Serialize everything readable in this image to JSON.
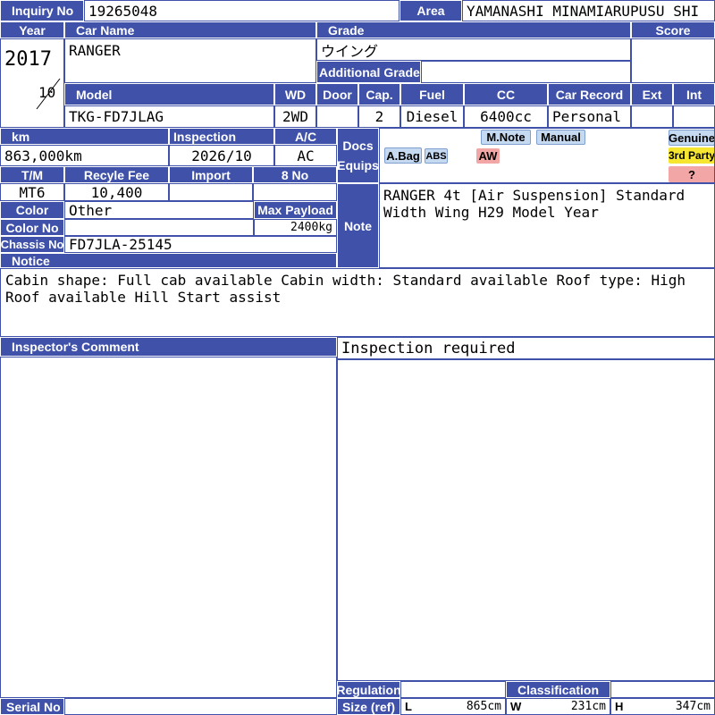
{
  "header": {
    "inquiry_no_label": "Inquiry No",
    "inquiry_no": "19265048",
    "area_label": "Area",
    "area": "YAMANASHI MINAMIARUPUSU SHI"
  },
  "vehicle": {
    "year_label": "Year",
    "year": "2017",
    "month": "10",
    "car_name_label": "Car Name",
    "car_name": "RANGER",
    "grade_label": "Grade",
    "grade": "ウイング",
    "additional_grade_label": "Additional Grade",
    "additional_grade": "",
    "score_label": "Score",
    "score": "",
    "model_label": "Model",
    "model": "TKG-FD7JLAG",
    "wd_label": "WD",
    "wd": "2WD",
    "door_label": "Door",
    "door": "",
    "cap_label": "Cap.",
    "cap": "2",
    "fuel_label": "Fuel",
    "fuel": "Diesel",
    "cc_label": "CC",
    "cc": "6400cc",
    "car_record_label": "Car Record",
    "car_record": "Personal",
    "ext_label": "Ext",
    "ext": "",
    "int_label": "Int",
    "int": ""
  },
  "details": {
    "km_label": "km",
    "km": "863,000km",
    "inspection_label": "Inspection",
    "inspection": "2026/10",
    "ac_label": "A/C",
    "ac": "AC",
    "tm_label": "T/M",
    "tm": "MT6",
    "recycle_fee_label": "Recyle Fee",
    "recycle_fee": "10,400",
    "import_label": "Import",
    "import": "",
    "eight_no_label": "8 No",
    "eight_no": "",
    "color_label": "Color",
    "color": "Other",
    "max_payload_label": "Max Payload",
    "max_payload": "2400kg",
    "color_no_label": "Color No",
    "color_no": "",
    "chassis_no_label": "Chassis No",
    "chassis_no": "FD7JLA-25145"
  },
  "docs_equips": {
    "label_docs": "Docs",
    "label_equips": "Equips",
    "badges": {
      "mnote": "M.Note",
      "manual": "Manual",
      "abag": "A.Bag",
      "abs": "ABS",
      "aw": "AW",
      "genuine": "Genuine",
      "third_party": "3rd Party",
      "question": "?"
    }
  },
  "note": {
    "label": "Note",
    "text": "RANGER 4t [Air Suspension] Standard Width Wing H29 Model Year"
  },
  "notice": {
    "label": "Notice",
    "text": "Cabin shape: Full cab available Cabin width: Standard available Roof type: High Roof available Hill Start assist"
  },
  "inspector": {
    "label": "Inspector's Comment",
    "comment": "Inspection required"
  },
  "footer": {
    "regulation_label": "Regulation",
    "regulation": "",
    "classification_label": "Classification",
    "classification": "",
    "size_label": "Size (ref)",
    "l_label": "L",
    "l_value": "865cm",
    "w_label": "W",
    "w_value": "231cm",
    "h_label": "H",
    "h_value": "347cm",
    "serial_no_label": "Serial No",
    "serial_no": ""
  },
  "colors": {
    "header_blue": "#3f51a9",
    "badge_blue": "#c5d9f1",
    "badge_yellow": "#f7e630",
    "badge_red": "#f3a6a6"
  }
}
